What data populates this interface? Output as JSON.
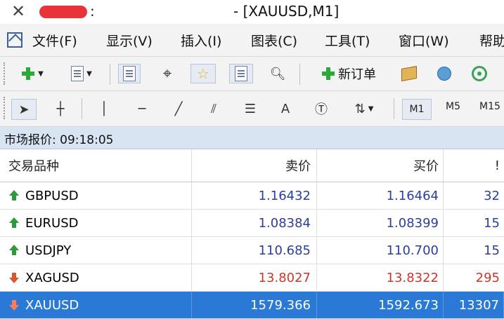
{
  "window": {
    "colon": ":",
    "title": "- [XAUUSD,M1]",
    "close_glyph": "✕"
  },
  "menu": {
    "items": [
      "文件(F)",
      "显示(V)",
      "插入(I)",
      "图表(C)",
      "工具(T)",
      "窗口(W)",
      "帮助"
    ]
  },
  "toolbar": {
    "new_order_label": "新订单",
    "text_tool": "A",
    "timeframes": [
      "M1",
      "M5",
      "M15"
    ]
  },
  "market_watch": {
    "title": "市场报价: 09:18:05",
    "columns": {
      "symbol": "交易品种",
      "bid": "卖价",
      "ask": "买价",
      "spread": "!"
    },
    "rows": [
      {
        "symbol": "GBPUSD",
        "bid": "1.16432",
        "ask": "1.16464",
        "spread": "32",
        "direction": "up"
      },
      {
        "symbol": "EURUSD",
        "bid": "1.08384",
        "ask": "1.08399",
        "spread": "15",
        "direction": "up"
      },
      {
        "symbol": "USDJPY",
        "bid": "110.685",
        "ask": "110.700",
        "spread": "15",
        "direction": "up"
      },
      {
        "symbol": "XAGUSD",
        "bid": "13.8027",
        "ask": "13.8322",
        "spread": "295",
        "direction": "down"
      },
      {
        "symbol": "XAUUSD",
        "bid": "1579.366",
        "ask": "1592.673",
        "spread": "13307",
        "direction": "down",
        "selected": true
      }
    ]
  },
  "colors": {
    "up_arrow": "#2e9a3c",
    "down_arrow": "#d9542f",
    "price_blue": "#2b3e9a",
    "price_red": "#c7372a",
    "selection": "#2a79d6",
    "header_band": "#d9e4f3"
  }
}
